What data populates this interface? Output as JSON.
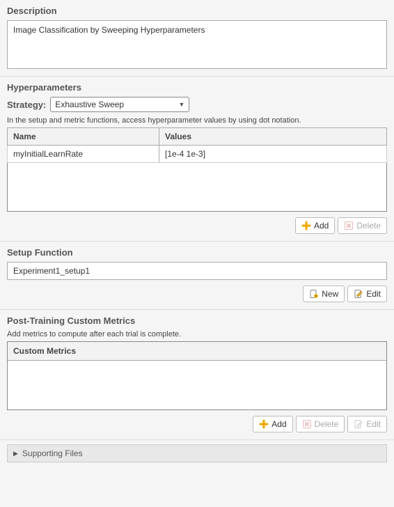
{
  "description": {
    "title": "Description",
    "value": "Image Classification by Sweeping Hyperparameters"
  },
  "hyperparameters": {
    "title": "Hyperparameters",
    "strategy_label": "Strategy:",
    "strategy_value": "Exhaustive Sweep",
    "hint": "In the setup and metric functions, access hyperparameter values by using dot notation.",
    "columns": {
      "name": "Name",
      "values": "Values"
    },
    "rows": [
      {
        "name": "myInitialLearnRate",
        "values": "[1e-4 1e-3]"
      }
    ],
    "buttons": {
      "add": "Add",
      "delete": "Delete"
    }
  },
  "setup": {
    "title": "Setup Function",
    "value": "Experiment1_setup1",
    "buttons": {
      "new": "New",
      "edit": "Edit"
    }
  },
  "metrics": {
    "title": "Post-Training Custom Metrics",
    "hint": "Add metrics to compute after each trial is complete.",
    "header": "Custom Metrics",
    "buttons": {
      "add": "Add",
      "delete": "Delete",
      "edit": "Edit"
    }
  },
  "supporting_files": {
    "title": "Supporting Files"
  }
}
